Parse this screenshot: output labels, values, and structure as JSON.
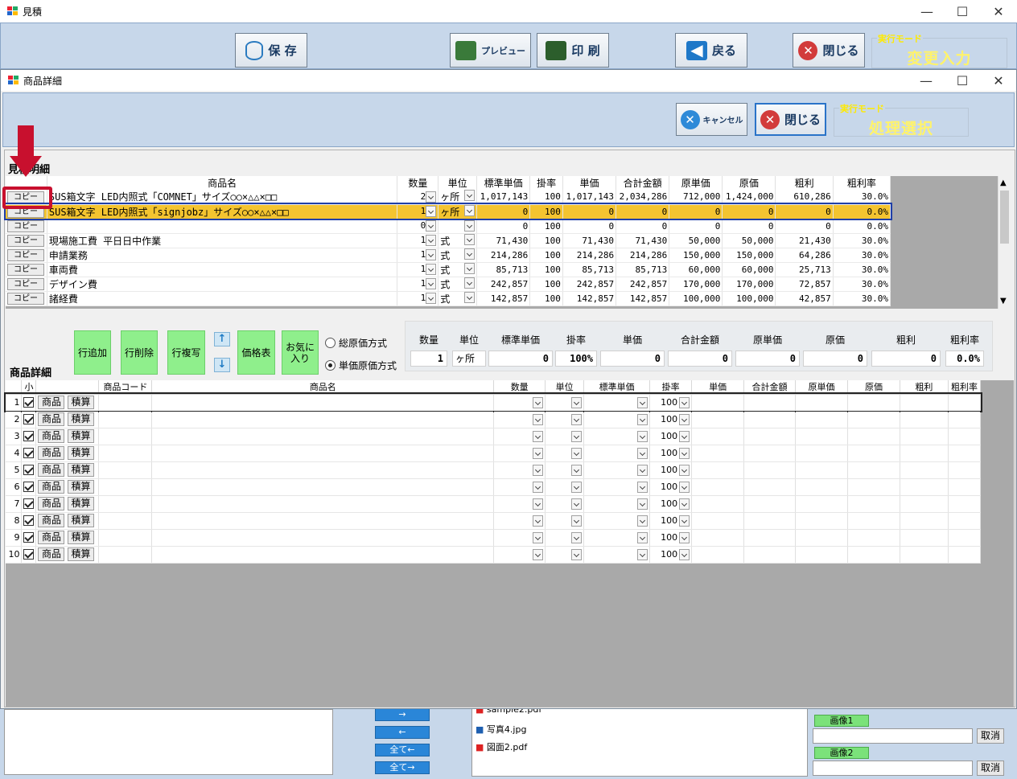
{
  "outer": {
    "title": "見積",
    "save": "保 存",
    "preview": "プレビュー",
    "print": "印 刷",
    "back": "戻る",
    "close": "閉じる",
    "mode_label": "実行モード",
    "mode_value": "変更入力"
  },
  "files": {
    "items": [
      "sample2.pdf",
      "写真4.jpg",
      "図面2.pdf"
    ],
    "btn_right": "→",
    "btn_left": "←",
    "btn_all_left": "全て←",
    "btn_all_right": "全て→",
    "image1": "画像1",
    "image2": "画像2",
    "cancel": "取消"
  },
  "inner": {
    "title": "商品詳細",
    "cancel": "キャンセル",
    "close": "閉じる",
    "mode_label": "実行モード",
    "mode_value": "処理選択",
    "section1": "見積明細",
    "section2": "商品詳細"
  },
  "grid1": {
    "headers": [
      "商品名",
      "数量",
      "単位",
      "標準単価",
      "掛率",
      "単価",
      "合計金額",
      "原単価",
      "原価",
      "粗利",
      "粗利率"
    ],
    "copy": "コピー",
    "rows": [
      {
        "name": "SUS箱文字 LED内照式「COMNET」サイズ○○×△△×□□",
        "qty": "2",
        "unit": "ヶ所",
        "std": "1,017,143",
        "rate": "100",
        "price": "1,017,143",
        "total": "2,034,286",
        "cprice": "712,000",
        "cost": "1,424,000",
        "profit": "610,286",
        "pct": "30.0%"
      },
      {
        "name": "SUS箱文字 LED内照式「signjobz」サイズ○○×△△×□□",
        "qty": "1",
        "unit": "ヶ所",
        "std": "0",
        "rate": "100",
        "price": "0",
        "total": "0",
        "cprice": "0",
        "cost": "0",
        "profit": "0",
        "pct": "0.0%"
      },
      {
        "name": "",
        "qty": "0",
        "unit": "",
        "std": "0",
        "rate": "100",
        "price": "0",
        "total": "0",
        "cprice": "0",
        "cost": "0",
        "profit": "0",
        "pct": "0.0%"
      },
      {
        "name": "現場施工費 平日日中作業",
        "qty": "1",
        "unit": "式",
        "std": "71,430",
        "rate": "100",
        "price": "71,430",
        "total": "71,430",
        "cprice": "50,000",
        "cost": "50,000",
        "profit": "21,430",
        "pct": "30.0%"
      },
      {
        "name": "申請業務",
        "qty": "1",
        "unit": "式",
        "std": "214,286",
        "rate": "100",
        "price": "214,286",
        "total": "214,286",
        "cprice": "150,000",
        "cost": "150,000",
        "profit": "64,286",
        "pct": "30.0%"
      },
      {
        "name": "車両費",
        "qty": "1",
        "unit": "式",
        "std": "85,713",
        "rate": "100",
        "price": "85,713",
        "total": "85,713",
        "cprice": "60,000",
        "cost": "60,000",
        "profit": "25,713",
        "pct": "30.0%"
      },
      {
        "name": "デザイン費",
        "qty": "1",
        "unit": "式",
        "std": "242,857",
        "rate": "100",
        "price": "242,857",
        "total": "242,857",
        "cprice": "170,000",
        "cost": "170,000",
        "profit": "72,857",
        "pct": "30.0%"
      },
      {
        "name": "諸経費",
        "qty": "1",
        "unit": "式",
        "std": "142,857",
        "rate": "100",
        "price": "142,857",
        "total": "142,857",
        "cprice": "100,000",
        "cost": "100,000",
        "profit": "42,857",
        "pct": "30.0%"
      }
    ]
  },
  "actions": {
    "add": "行追加",
    "del": "行削除",
    "copy": "行複写",
    "up": "↑",
    "down": "↓",
    "pricelist": "価格表",
    "fav": "お気に入り",
    "radio1": "総原価方式",
    "radio2": "単価原価方式"
  },
  "summary": {
    "labels": [
      "数量",
      "単位",
      "標準単価",
      "掛率",
      "単価",
      "合計金額",
      "原単価",
      "原価",
      "粗利",
      "粗利率"
    ],
    "values": [
      "1",
      "ヶ所",
      "0",
      "100%",
      "0",
      "0",
      "0",
      "0",
      "0",
      "0.0%"
    ]
  },
  "grid2": {
    "headers": [
      "小",
      "商品コード",
      "商品名",
      "数量",
      "単位",
      "標準単価",
      "掛率",
      "単価",
      "合計金額",
      "原単価",
      "原価",
      "粗利",
      "粗利率"
    ],
    "btn1": "商品",
    "btn2": "積算",
    "rate": "100",
    "rows": [
      "1",
      "2",
      "3",
      "4",
      "5",
      "6",
      "7",
      "8",
      "9",
      "10"
    ]
  }
}
